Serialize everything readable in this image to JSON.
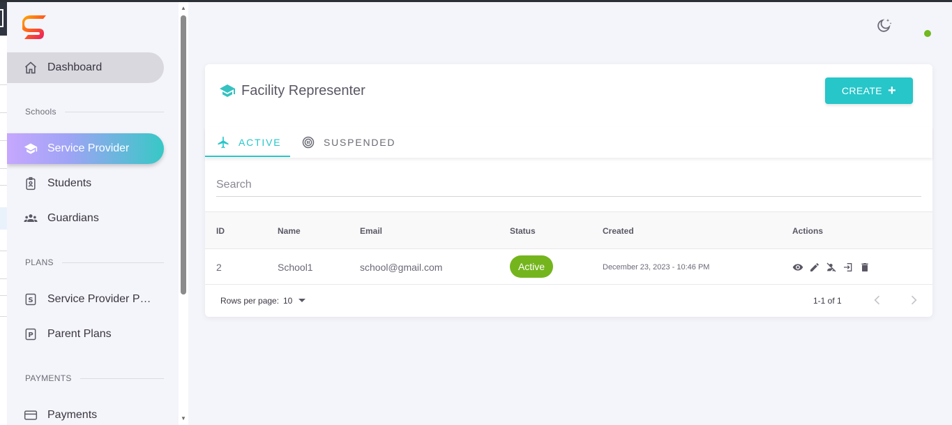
{
  "sidebar": {
    "logo_letter": "S",
    "items": {
      "dashboard": "Dashboard",
      "service_provider": "Service Provider",
      "students": "Students",
      "guardians": "Guardians",
      "service_provider_plans": "Service Provider Plans",
      "parent_plans": "Parent Plans",
      "payments": "Payments"
    },
    "sections": {
      "schools": "Schools",
      "plans": "PLANS",
      "payments": "PAYMENTS"
    }
  },
  "header": {
    "theme_icon": "moon-star-icon",
    "status_color": "#72b81e"
  },
  "card": {
    "title": "Facility Representer",
    "create_label": "CREATE",
    "tabs": {
      "active": "ACTIVE",
      "suspended": "SUSPENDED"
    },
    "search_placeholder": "Search",
    "columns": {
      "id": "ID",
      "name": "Name",
      "email": "Email",
      "status": "Status",
      "created": "Created",
      "actions": "Actions"
    },
    "rows": [
      {
        "id": "2",
        "name": "School1",
        "email": "school@gmail.com",
        "status": "Active",
        "created": "December 23, 2023 - 10:46 PM"
      }
    ],
    "footer": {
      "rows_per_page_label": "Rows per page:",
      "rows_per_page_value": "10",
      "range": "1-1 of 1"
    }
  },
  "colors": {
    "accent": "#26c6c9",
    "status_active": "#74b51d"
  }
}
